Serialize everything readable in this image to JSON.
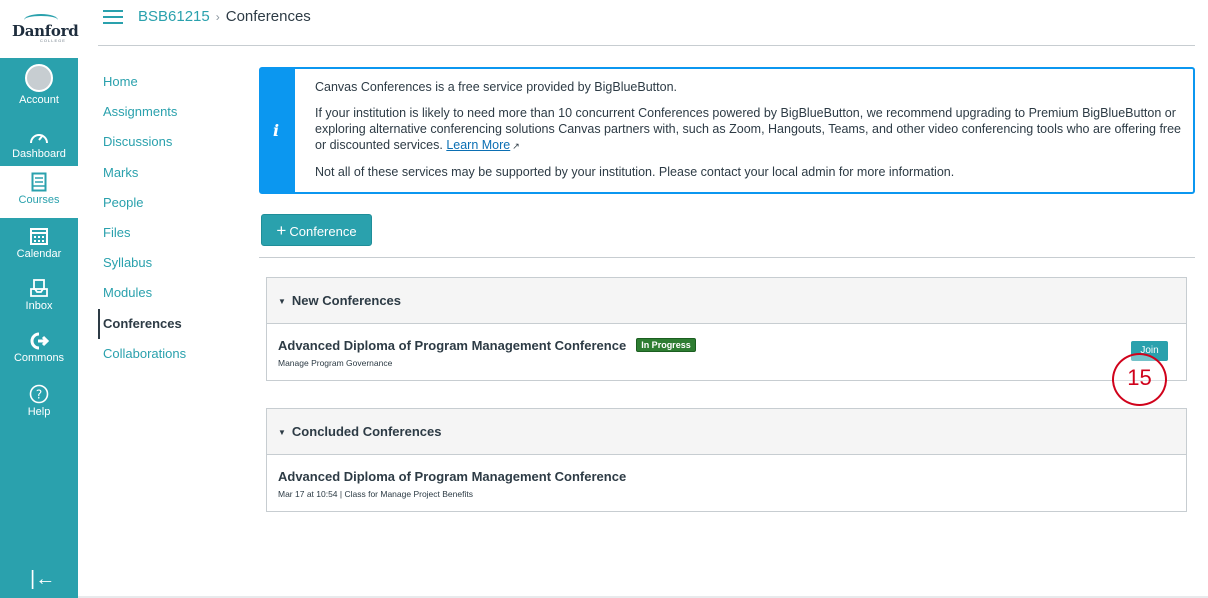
{
  "brand": {
    "logo_text": "Danford",
    "logo_sub": "COLLEGE",
    "accent": "#2aa1ad",
    "info": "#0b97f0",
    "success": "#2e7d32",
    "marker": "#d0021b"
  },
  "global_nav": [
    {
      "label": "Account",
      "icon": "account-avatar-icon"
    },
    {
      "label": "Dashboard",
      "icon": "dashboard-gauge-icon"
    },
    {
      "label": "Courses",
      "icon": "courses-book-icon",
      "active": true
    },
    {
      "label": "Calendar",
      "icon": "calendar-icon"
    },
    {
      "label": "Inbox",
      "icon": "inbox-icon"
    },
    {
      "label": "Commons",
      "icon": "commons-icon"
    },
    {
      "label": "Help",
      "icon": "help-icon"
    }
  ],
  "collapse_glyph": "|←",
  "breadcrumb": {
    "course": "BSB61215",
    "separator": "›",
    "current": "Conferences"
  },
  "course_nav": [
    "Home",
    "Assignments",
    "Discussions",
    "Marks",
    "People",
    "Files",
    "Syllabus",
    "Modules",
    "Conferences",
    "Collaborations"
  ],
  "alert": {
    "icon_glyph": "i",
    "p1": "Canvas Conferences is a free service provided by BigBlueButton.",
    "p2": "If your institution is likely to need more than 10 concurrent Conferences powered by BigBlueButton, we recommend upgrading to Premium BigBlueButton or exploring alternative conferencing solutions Canvas partners with, such as Zoom, Hangouts, Teams, and other video conferencing tools who are offering free or discounted services.",
    "link": "Learn More",
    "p3": "Not all of these services may be supported by your institution. Please contact your local admin for more information."
  },
  "add_button": {
    "plus": "+",
    "label": "Conference"
  },
  "new_section": {
    "title": "New Conferences",
    "conference": {
      "title": "Advanced Diploma of Program Management Conference",
      "badge": "In Progress",
      "subtitle": "Manage Program Governance",
      "join": "Join"
    }
  },
  "concluded_section": {
    "title": "Concluded Conferences",
    "conference": {
      "title": "Advanced Diploma of Program Management Conference",
      "subtitle": "Mar 17 at 10:54  |  Class for Manage Project Benefits"
    }
  },
  "marker_label": "15"
}
